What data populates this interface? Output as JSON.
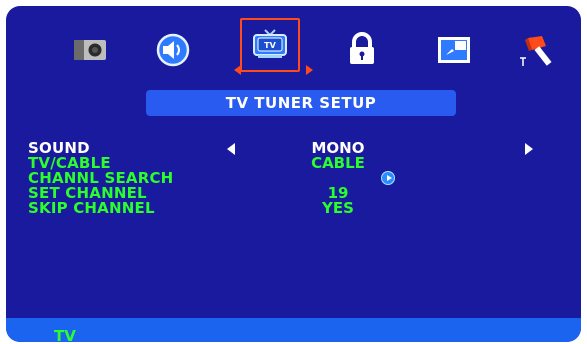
{
  "tabs": [
    {
      "name": "picture",
      "icon": "camera-icon"
    },
    {
      "name": "sound",
      "icon": "speaker-icon"
    },
    {
      "name": "tv",
      "icon": "tv-icon",
      "label": "TV",
      "selected": true
    },
    {
      "name": "lock",
      "icon": "lock-icon"
    },
    {
      "name": "screen",
      "icon": "screen-icon"
    },
    {
      "name": "setup",
      "icon": "hammer-icon"
    }
  ],
  "title": "TV TUNER SETUP",
  "menu": [
    {
      "label": "SOUND",
      "value": "MONO",
      "active": true
    },
    {
      "label": "TV/CABLE",
      "value": "CABLE"
    },
    {
      "label": "CHANNL SEARCH",
      "value": ""
    },
    {
      "label": "SET CHANNEL",
      "value": "19"
    },
    {
      "label": "SKIP CHANNEL",
      "value": "YES"
    }
  ],
  "footer": {
    "label": "TV"
  },
  "colors": {
    "background": "#1a1a9e",
    "title_bar": "#2a5bf0",
    "menu_text": "#2bff2b",
    "active_text": "#ffffff",
    "selection": "#ff4a1a",
    "footer_bar": "#1a64f0"
  }
}
